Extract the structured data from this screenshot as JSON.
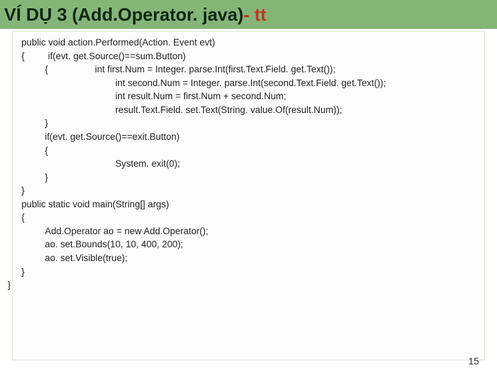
{
  "header": {
    "title_part1": "VÍ DỤ 3 (Add.Operator. java) ",
    "title_part2": "- tt"
  },
  "code": {
    "l0": "public void action.Performed(Action. Event evt)",
    "l1": "{",
    "l1b": "if(evt. get.Source()==sum.Button)",
    "l2": "{",
    "l2b": "int first.Num = Integer. parse.Int(first.Text.Field. get.Text());",
    "l3": "int second.Num = Integer. parse.Int(second.Text.Field. get.Text());",
    "l4": "int result.Num = first.Num + second.Num;",
    "l5": "result.Text.Field. set.Text(String. value.Of(result.Num));",
    "l6": "}",
    "l7": "if(evt. get.Source()==exit.Button)",
    "l8": "{",
    "l9": "System. exit(0);",
    "l10": "}",
    "l11": "}",
    "l12": "public static void main(String[] args)",
    "l13": "{",
    "l14": "Add.Operator ao = new Add.Operator();",
    "l15": "ao. set.Bounds(10, 10, 400, 200);",
    "l16": "ao. set.Visible(true);",
    "l17": "}",
    "l18": "}"
  },
  "page_number": "15"
}
